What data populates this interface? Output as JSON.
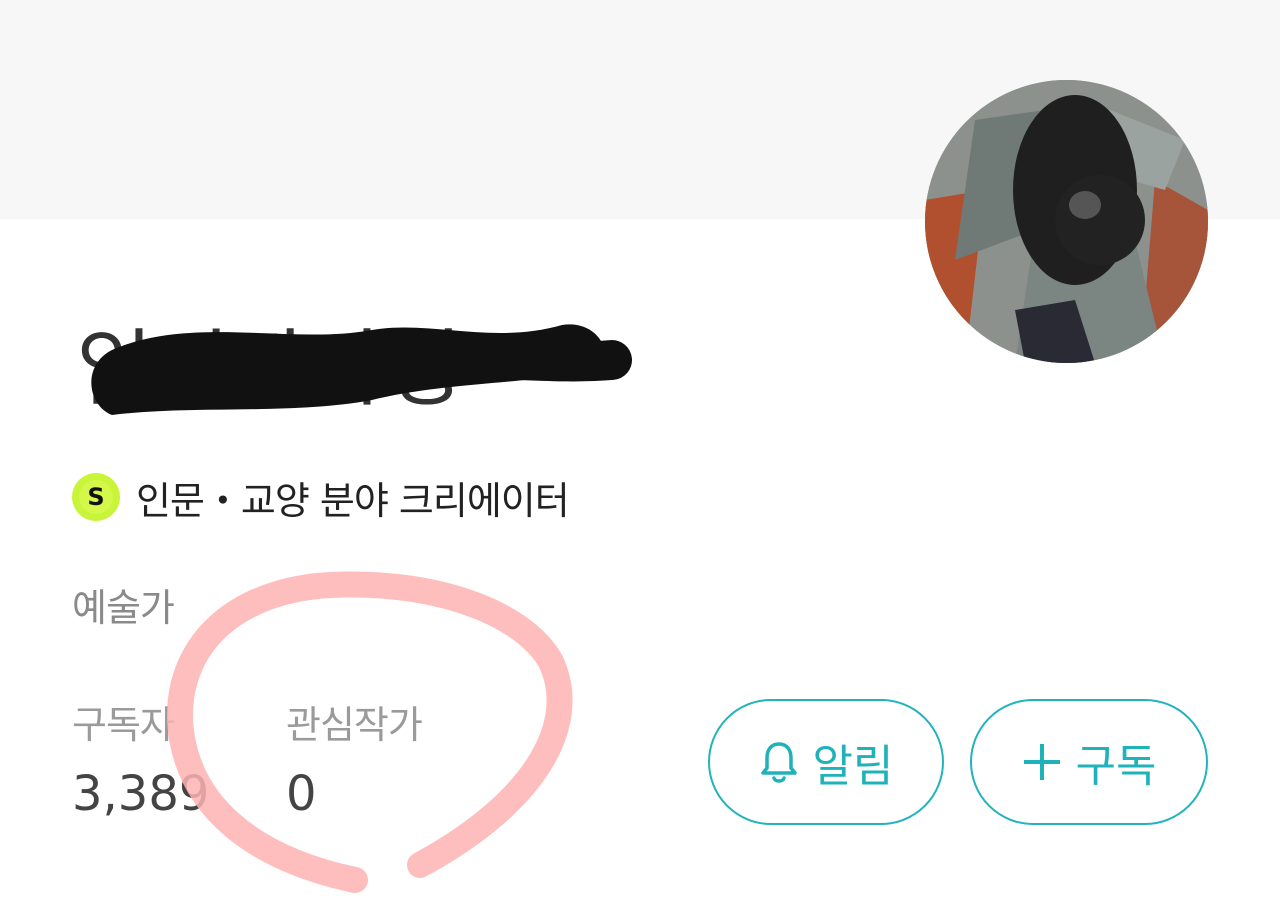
{
  "profile": {
    "author_name": "임시작가명",
    "creator_badge_letter": "S",
    "creator_category": "인문・교양 분야 크리에이터",
    "job": "예술가"
  },
  "stats": {
    "subscribers_label": "구독자",
    "subscribers_value": "3,389",
    "following_label": "관심작가",
    "following_value": "0"
  },
  "actions": {
    "notify_label": "알림",
    "notify_icon": "bell-icon",
    "subscribe_label": "구독",
    "subscribe_icon": "plus-icon"
  },
  "colors": {
    "accent": "#22b3bd",
    "badge": "#c8f53a",
    "annotation": "#ffb3b3"
  }
}
